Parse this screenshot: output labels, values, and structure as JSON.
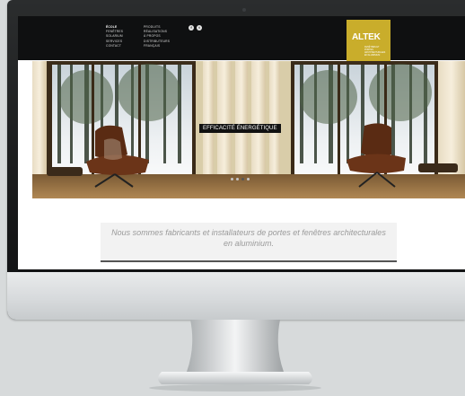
{
  "nav": {
    "col1": [
      "ÉCOLE",
      "FENÊTRES",
      "SOLARIUM",
      "SERVICES",
      "CONTACT"
    ],
    "col2": [
      "PRODUITS",
      "RÉALISATIONS",
      "À PROPOS",
      "DISTRIBUTEURS",
      "FRANÇAIS"
    ],
    "active_index": 0
  },
  "social": {
    "icons": [
      "facebook-icon",
      "twitter-icon"
    ],
    "glyphs": [
      "f",
      "t"
    ]
  },
  "logo": {
    "text": "ALTEK",
    "tagline": "FENÊTRES ET PORTES ARCHITECTURALES EN ALUMINIUM"
  },
  "hero": {
    "banner": "EFFICACITÉ ÉNERGÉTIQUE",
    "slides": 4,
    "active_slide": 2
  },
  "tagline": {
    "text": "Nous sommes fabricants et installateurs de portes et fenêtres architecturales en aluminium."
  }
}
